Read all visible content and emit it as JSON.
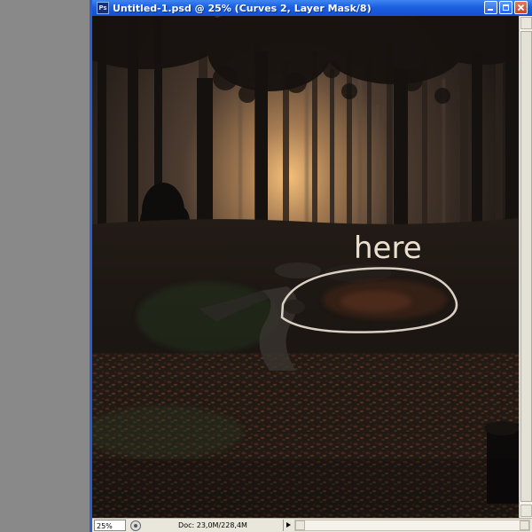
{
  "window": {
    "title": "Untitled-1.psd @ 25% (Curves 2, Layer Mask/8)",
    "app_icon_text": "Ps"
  },
  "canvas": {
    "annotation_text": "here"
  },
  "statusbar": {
    "zoom_value": "25%",
    "doc_info": "Doc: 23,0M/228,4M"
  },
  "icons": {
    "app": "photoshop-icon",
    "minimize": "minimize-icon",
    "maximize": "maximize-icon",
    "close": "close-icon",
    "status": "status-info-icon",
    "menu": "play-arrow-icon"
  },
  "colors": {
    "titlebar": "#1b5fe0",
    "close_button": "#c9462a",
    "annotation": "#e8dccb"
  }
}
